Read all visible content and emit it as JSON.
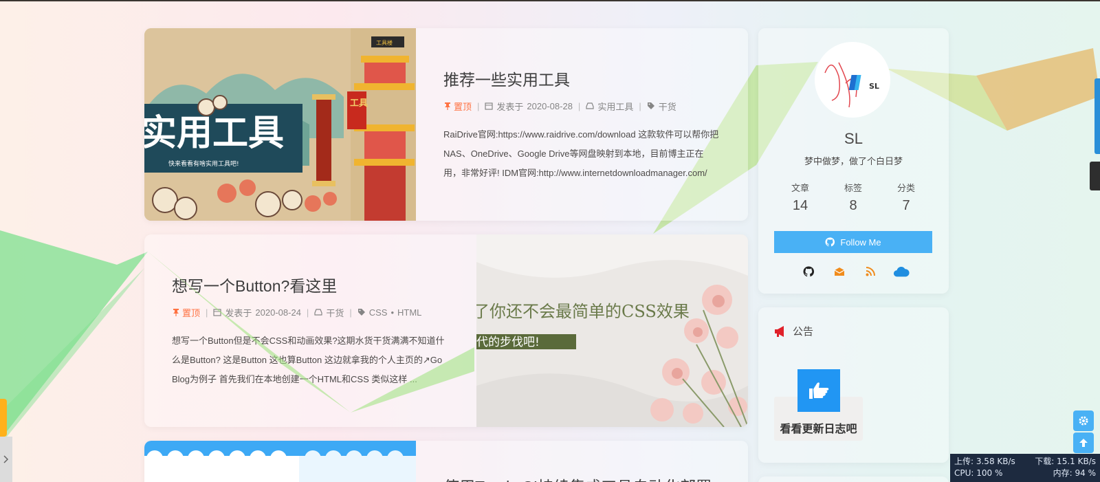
{
  "posts": [
    {
      "title": "推荐一些实用工具",
      "sticky": "置顶",
      "date_prefix": "发表于",
      "date": "2020-08-28",
      "category": "实用工具",
      "tags": [
        "干货"
      ],
      "excerpt": "RaiDrive官网:https://www.raidrive.com/download 这款软件可以帮你把NAS、OneDrive、Google Drive等网盘映射到本地，目前博主正在用，非常好评! IDM官网:http://www.internetdownloadmanager.com/ 这...",
      "cover_title": "实用工具",
      "cover_subtitle": "快来看看有啥实用工具吧!",
      "cover_sign": "工具",
      "cover_tower_sign": "工具楼"
    },
    {
      "title": "想写一个Button?看这里",
      "sticky": "置顶",
      "date_prefix": "发表于",
      "date": "2020-08-24",
      "category": "干货",
      "tags": [
        "CSS",
        "HTML"
      ],
      "tag_sep": "•",
      "excerpt": "想写一个Button但是不会CSS和动画效果?这期水货干货满满不知道什么是Button? 这是Button 这也算Button 这边就拿我的个人主页的↗Go Blog为例子 首先我们在本地创建一个HTML和CSS 类似这样 ...",
      "cover_line1": "了你还不会最简单的CSS效果",
      "cover_line2": "代的步伐吧!"
    },
    {
      "title": "使用Travis CI持续集成工具自动化部署"
    }
  ],
  "author": {
    "name": "SL",
    "description": "梦中做梦，做了个白日梦",
    "avatar_text": "SL",
    "stats": [
      {
        "label": "文章",
        "value": "14"
      },
      {
        "label": "标签",
        "value": "8"
      },
      {
        "label": "分类",
        "value": "7"
      }
    ],
    "follow_label": "Follow Me",
    "social_icons": [
      "github-icon",
      "email-icon",
      "rss-icon",
      "cloud-icon"
    ]
  },
  "announcement": {
    "title": "公告",
    "update_label": "看看更新日志吧"
  },
  "netmon": {
    "upload": "上传: 3.58 KB/s",
    "download": "下载: 15.1 KB/s",
    "cpu": "CPU: 100 %",
    "memory": "内存: 94 %"
  },
  "colors": {
    "accent": "#49b1f5",
    "sticky": "#ff7242",
    "update_icon_bg": "#2196f3"
  }
}
